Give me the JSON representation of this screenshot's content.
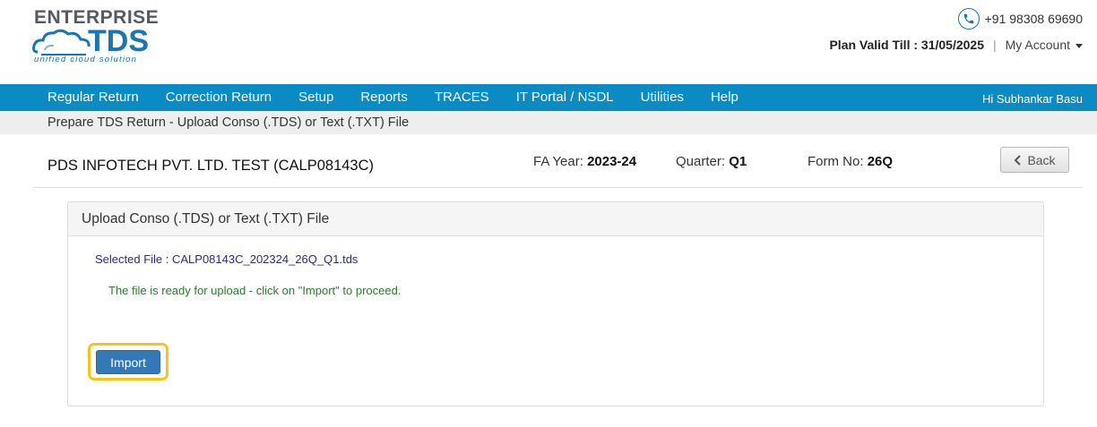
{
  "brand": {
    "top": "ENTERPRISE",
    "main": "TDS",
    "tagline": "unified cloud solution"
  },
  "header": {
    "phone": "+91 98308 69690",
    "plan_label": "Plan Valid Till : 31/05/2025",
    "separator": "|",
    "my_account": "My Account"
  },
  "nav": {
    "items": [
      "Regular Return",
      "Correction Return",
      "Setup",
      "Reports",
      "TRACES",
      "IT Portal / NSDL",
      "Utilities",
      "Help"
    ],
    "user": "Hi Subhankar Basu"
  },
  "breadcrumb": "Prepare TDS Return - Upload Conso (.TDS) or Text (.TXT) File",
  "title_row": {
    "company": "PDS INFOTECH PVT. LTD. TEST (CALP08143C)",
    "fa_label": "FA Year:",
    "fa_value": "2023-24",
    "quarter_label": "Quarter:",
    "quarter_value": "Q1",
    "form_label": "Form No:",
    "form_value": "26Q",
    "back_label": "Back"
  },
  "panel": {
    "title": "Upload Conso (.TDS) or Text (.TXT) File",
    "selected_file": "Selected File : CALP08143C_202324_26Q_Q1.tds",
    "ready_message": "The file is ready for upload - click on \"Import\" to proceed.",
    "import_label": "Import"
  },
  "colors": {
    "nav_bg": "#0a8bc4",
    "brand_blue": "#1a75b0",
    "import_highlight": "#f5c518",
    "import_button": "#3479b7"
  }
}
